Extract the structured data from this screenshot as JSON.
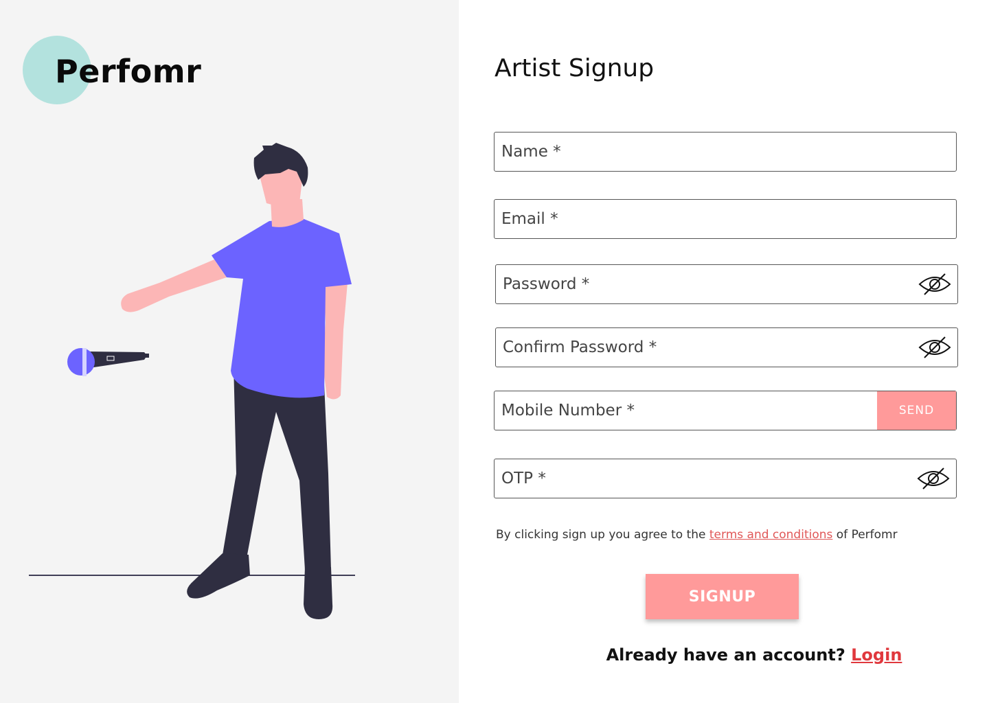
{
  "brand": {
    "name": "Perfomr",
    "logo_color": "#b3e2de"
  },
  "form": {
    "title": "Artist Signup",
    "name_placeholder": "Name *",
    "email_placeholder": "Email *",
    "password_placeholder": "Password *",
    "confirm_password_placeholder": "Confirm Password *",
    "mobile_placeholder": "Mobile Number *",
    "send_label": "SEND",
    "otp_placeholder": "OTP *",
    "password_visibility_icon": "eye-slash-icon"
  },
  "terms": {
    "prefix": "By clicking sign up you agree to the ",
    "link_text": "terms and conditions",
    "suffix": " of Perfomr"
  },
  "signup_label": "SIGNUP",
  "login": {
    "question": "Already have an account? ",
    "link_text": "Login"
  },
  "colors": {
    "accent": "#ff9a9a",
    "link": "#e05757",
    "left_panel_bg": "#f4f4f4",
    "shirt": "#6c63ff",
    "dark": "#2f2e41",
    "skin": "#fcb6b6"
  }
}
